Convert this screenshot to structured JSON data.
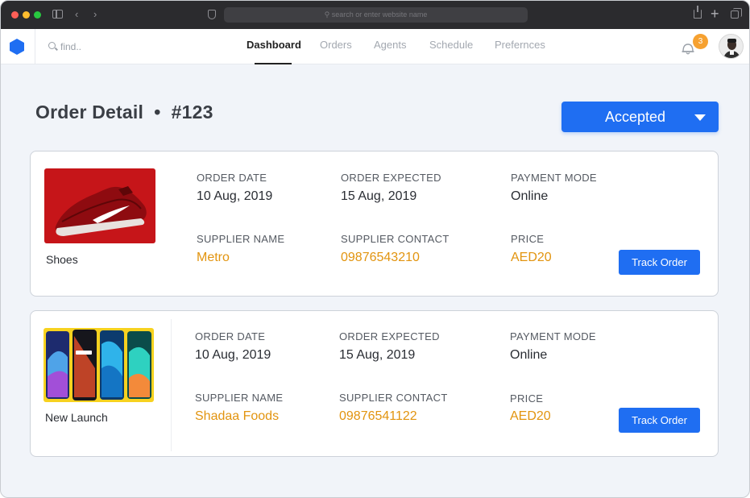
{
  "browser": {
    "url_placeholder": "search or enter website name"
  },
  "header": {
    "search_placeholder": "find..",
    "nav": [
      {
        "label": "Dashboard",
        "active": true
      },
      {
        "label": "Orders",
        "active": false
      },
      {
        "label": "Agents",
        "active": false
      },
      {
        "label": "Schedule",
        "active": false
      },
      {
        "label": "Prefernces",
        "active": false
      }
    ],
    "notification_count": "3"
  },
  "page": {
    "title": "Order Detail  •  #123",
    "status": "Accepted"
  },
  "labels": {
    "order_date": "ORDER DATE",
    "order_expected": "ORDER EXPECTED",
    "payment_mode": "PAYMENT MODE",
    "supplier_name": "SUPPLIER NAME",
    "supplier_contact": "SUPPLIER CONTACT",
    "price": "PRICE",
    "track_order": "Track Order"
  },
  "orders": [
    {
      "product": "Shoes",
      "order_date": "10 Aug, 2019",
      "order_expected": "15 Aug, 2019",
      "payment_mode": "Online",
      "supplier_name": "Metro",
      "supplier_contact": "09876543210",
      "price": "AED20"
    },
    {
      "product": "New Launch",
      "order_date": "10 Aug, 2019",
      "order_expected": "15 Aug, 2019",
      "payment_mode": "Online",
      "supplier_name": "Shadaa Foods",
      "supplier_contact": "09876541122",
      "price": "AED20"
    }
  ],
  "colors": {
    "primary": "#1f6ef2",
    "accent": "#e2940f",
    "badge": "#f6a130",
    "background": "#f1f4f9"
  }
}
